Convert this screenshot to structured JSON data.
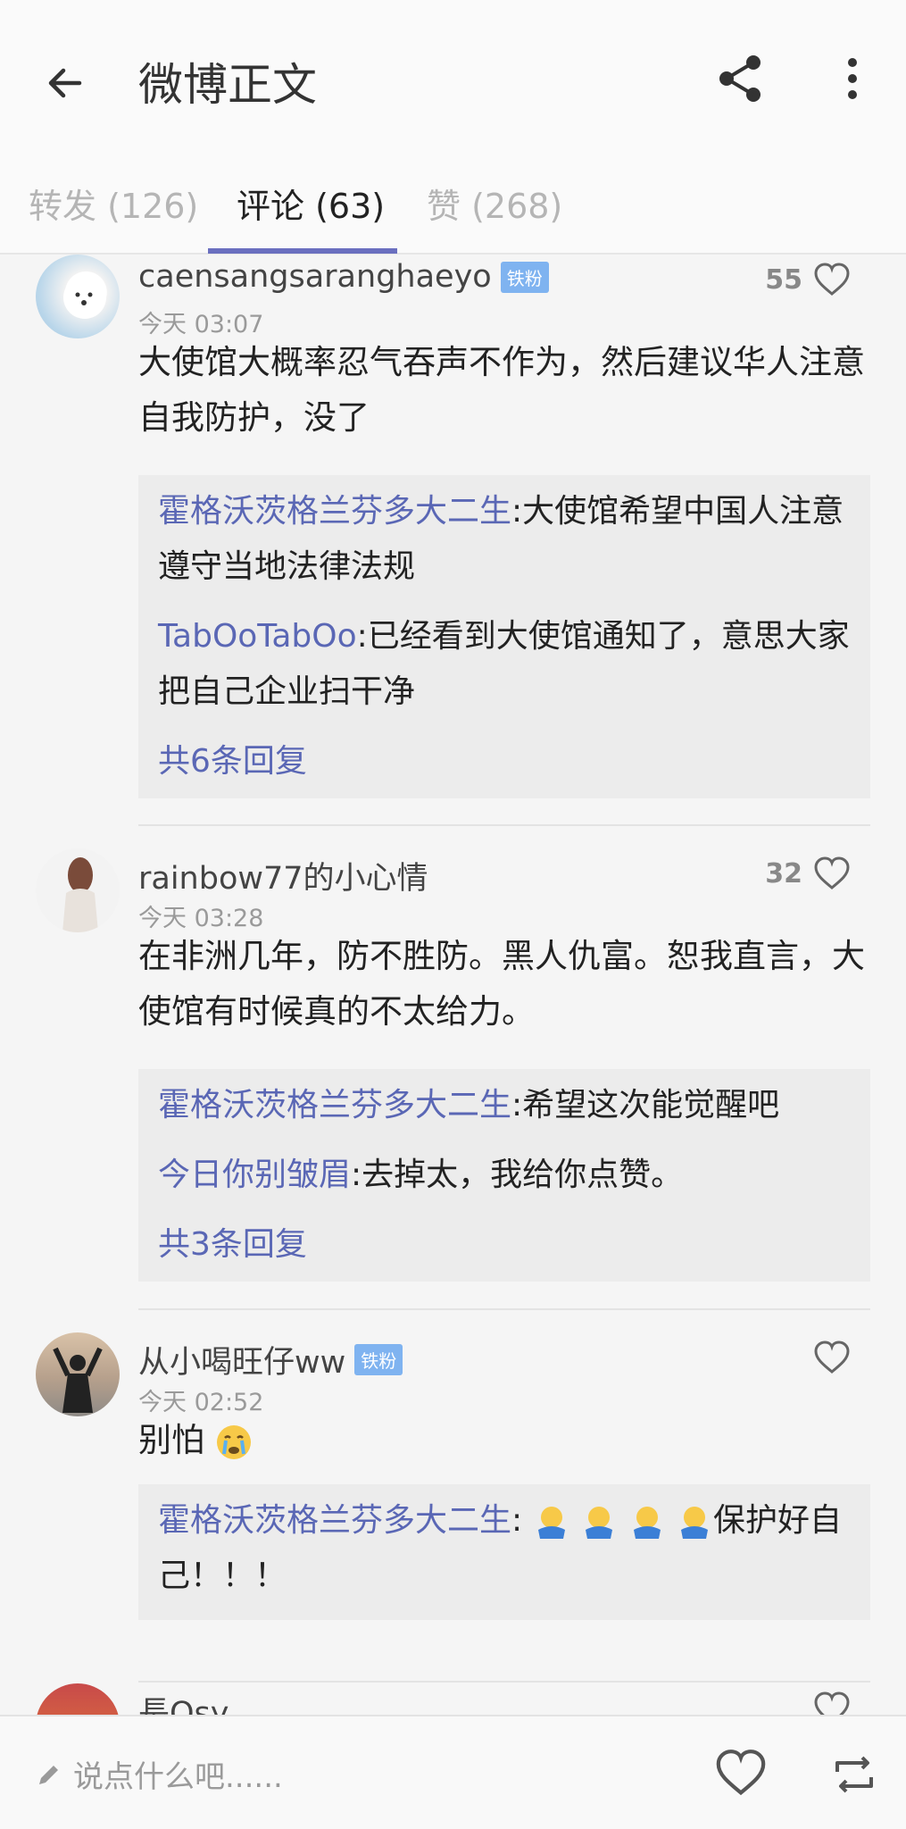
{
  "header": {
    "title": "微博正文",
    "back_icon": "arrow-left-icon",
    "share_icon": "share-icon",
    "more_icon": "more-vertical-icon"
  },
  "tabs": [
    {
      "label": "转发 (126)"
    },
    {
      "label": "评论 (63)"
    },
    {
      "label": "赞 (268)"
    }
  ],
  "accent_color": "#6a6fbf",
  "link_color": "#5a67b5",
  "comments": [
    {
      "user": "caensangsaranghaeyo",
      "badge": "铁粉",
      "time": "今天 03:07",
      "likes": "55",
      "text": "大使馆大概率忍气吞声不作为，然后建议华人注意自我防护，没了",
      "replies": [
        {
          "user": "霍格沃茨格兰芬多大二生",
          "text": ":大使馆希望中国人注意遵守当地法律法规"
        },
        {
          "user": "TabOoTabOo",
          "text": ":已经看到大使馆通知了，意思大家把自己企业扫干净"
        }
      ],
      "more_replies": "共6条回复"
    },
    {
      "user": "rainbow77的小心情",
      "time": "今天 03:28",
      "likes": "32",
      "text": "在非洲几年，防不胜防。黑人仇富。恕我直言，大使馆有时候真的不太给力。",
      "replies": [
        {
          "user": "霍格沃茨格兰芬多大二生",
          "text": ":希望这次能觉醒吧"
        },
        {
          "user": "今日你别皱眉",
          "text": ":去掉太，我给你点赞。"
        }
      ],
      "more_replies": "共3条回复"
    },
    {
      "user": "从小喝旺仔ww",
      "badge": "铁粉",
      "time": "今天 02:52",
      "text": "别怕",
      "replies": [
        {
          "user": "霍格沃茨格兰芬多大二生",
          "text": ":",
          "after_emoji": "保护好自己！！！"
        }
      ]
    },
    {
      "user": "長Qsy"
    }
  ],
  "bottom": {
    "placeholder": "说点什么吧......",
    "pencil_icon": "pencil-icon",
    "like_icon": "heart-icon",
    "repost_icon": "repost-icon"
  }
}
